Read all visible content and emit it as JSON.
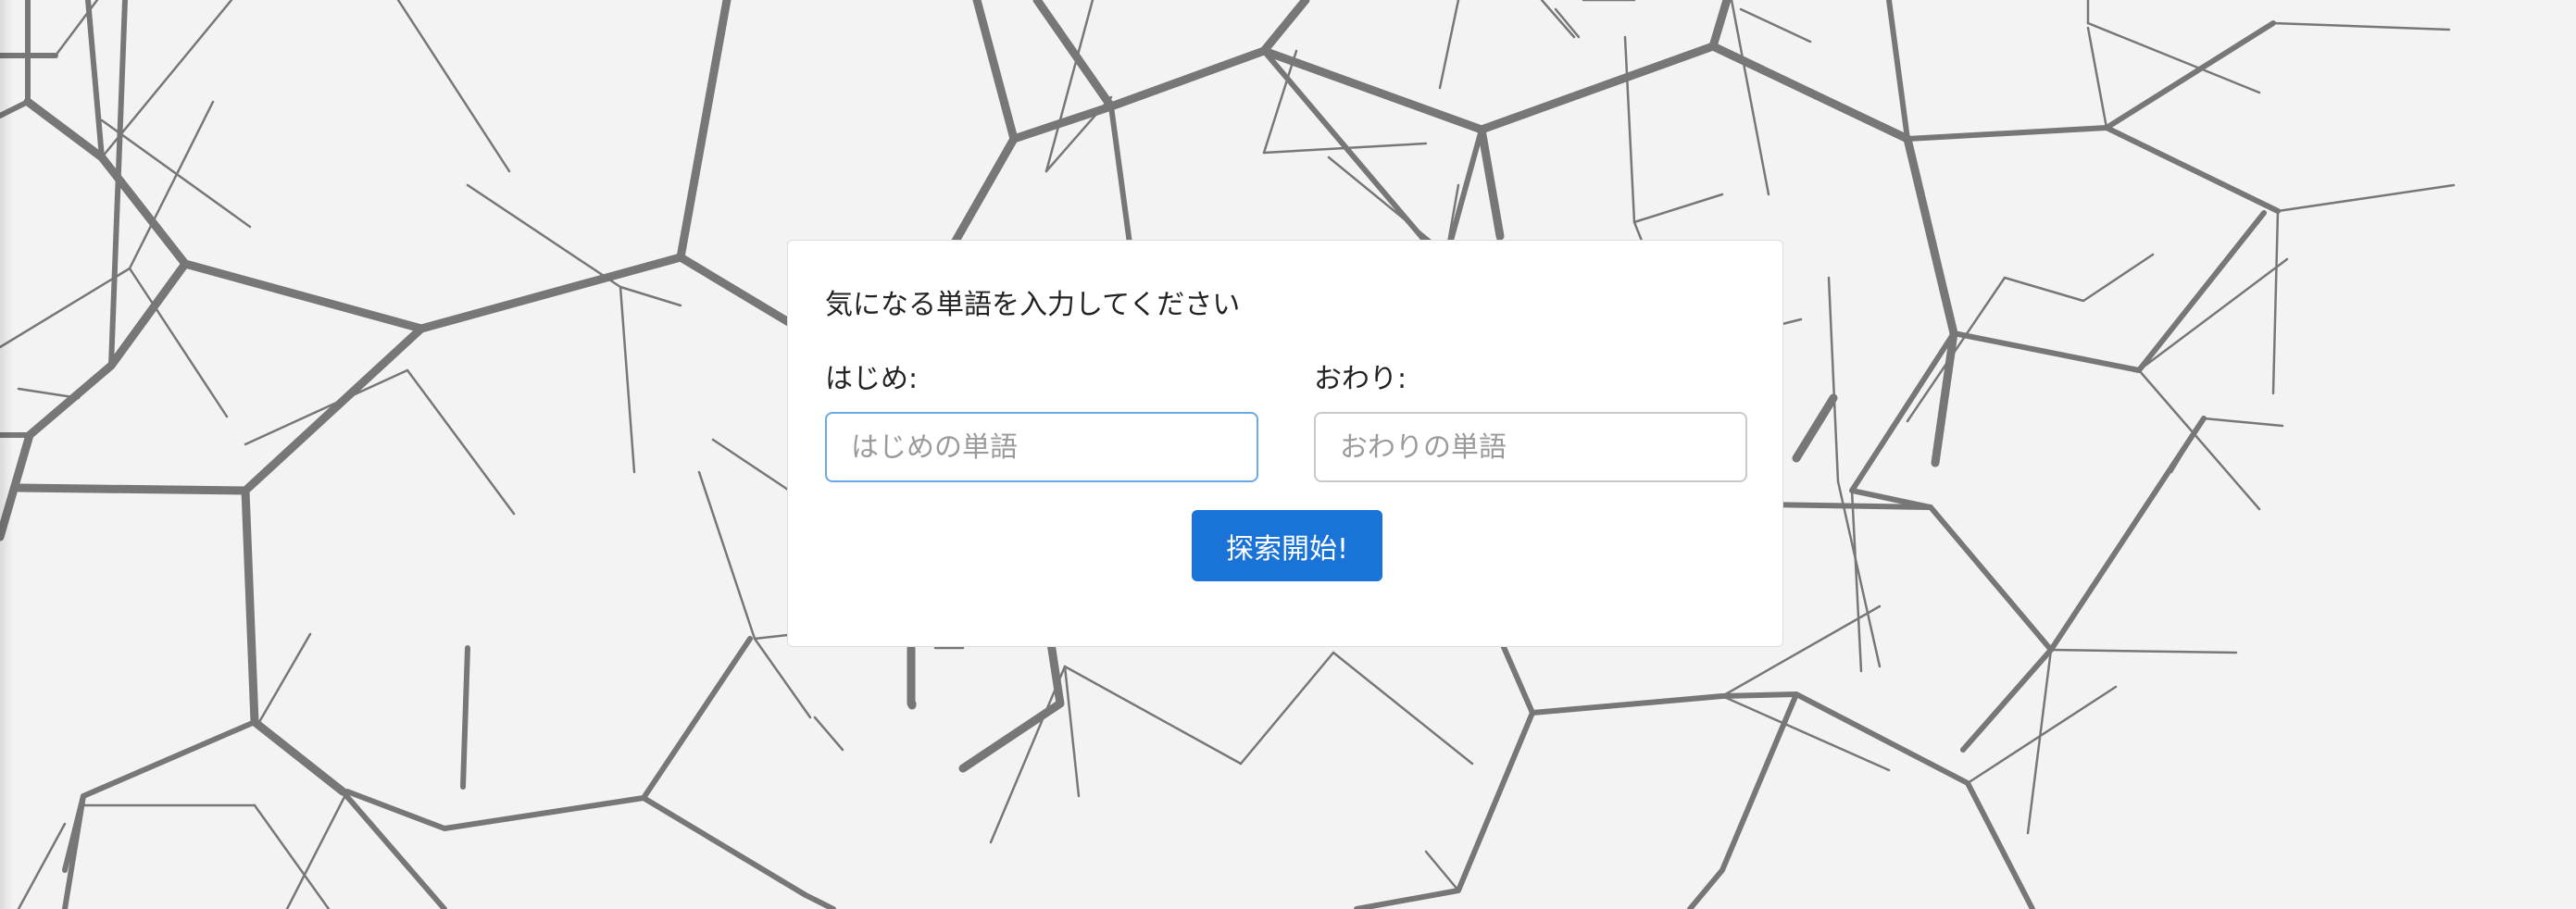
{
  "colors": {
    "background": "#f3f3f3",
    "lines": "#777777",
    "card": "#ffffff",
    "button": "#1a73d6"
  },
  "form": {
    "prompt": "気になる単語を入力してください",
    "start_label": "はじめ:",
    "start_placeholder": "はじめの単語",
    "start_value": "",
    "end_label": "おわり:",
    "end_placeholder": "おわりの単語",
    "end_value": "",
    "submit_label": "探索開始!"
  }
}
